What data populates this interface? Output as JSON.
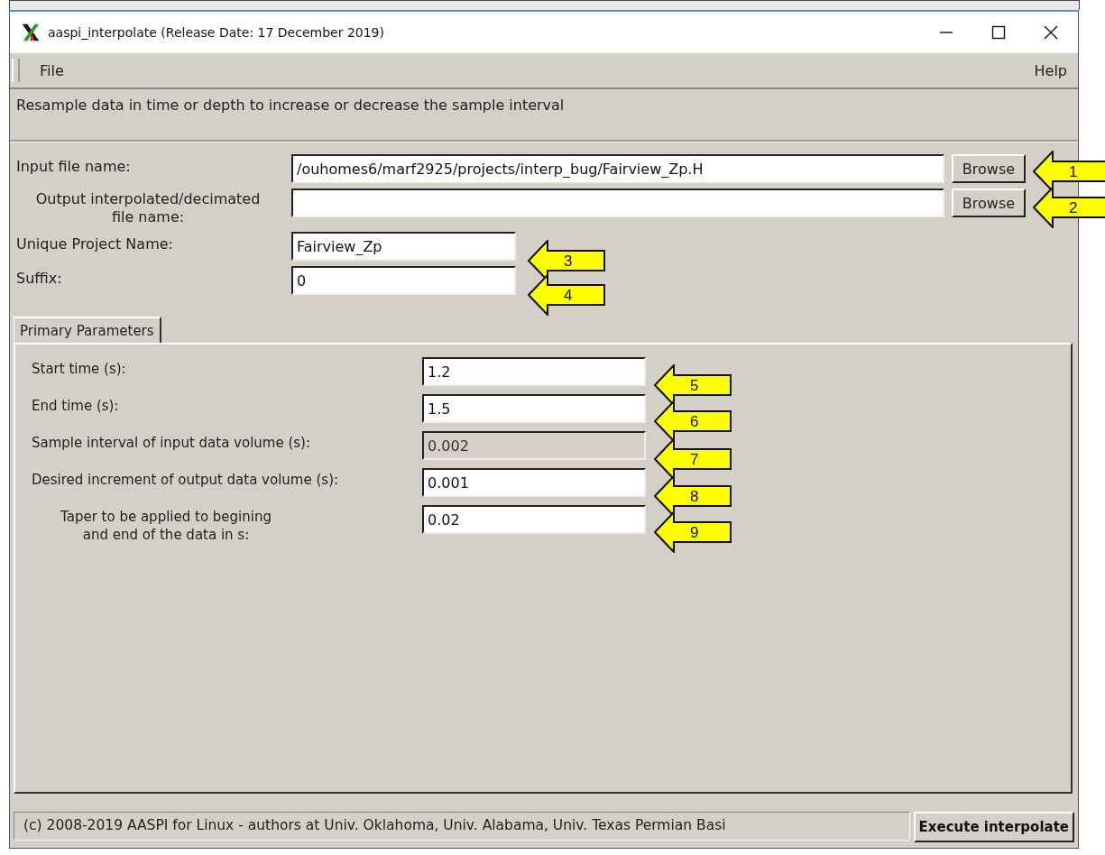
{
  "window": {
    "title": "aaspi_interpolate (Release Date: 17 December 2019)"
  },
  "menu": [
    {
      "label": "File"
    },
    {
      "label": "Help"
    }
  ],
  "description": "Resample data in time or depth to increase or decrease the sample interval",
  "file_fields": [
    {
      "label": "Input file name:",
      "value": "/ouhomes6/marf2925/projects/interp_bug/Fairview_Zp.H",
      "button": "Browse"
    },
    {
      "label": "Output interpolated/decimated\nfile name:",
      "button": "Browse"
    }
  ],
  "project_fields": [
    {
      "label": "Unique Project Name:",
      "value": "Fairview_Zp"
    },
    {
      "label": "Suffix:",
      "value": "0"
    }
  ],
  "tabs": [
    {
      "label": "Primary Parameters",
      "selected": true
    }
  ],
  "parameters": [
    {
      "label": "Start time (s):",
      "value": "1.2",
      "disabled": false
    },
    {
      "label": "End time (s):",
      "value": "1.5",
      "disabled": false
    },
    {
      "label": "Sample interval of input data volume (s):",
      "value": "0.002",
      "disabled": true
    },
    {
      "label": "Desired increment of output data volume (s):",
      "value": "0.001",
      "disabled": false
    },
    {
      "label": "Taper to be applied to begining\nand end of the data in s:",
      "value": "0.02",
      "disabled": false
    }
  ],
  "status_bar": "(c) 2008-2019 AASPI for Linux - authors at Univ. Oklahoma, Univ. Alabama, Univ. Texas Permian Basi",
  "execute_button": "Execute interpolate",
  "callouts": [
    "1",
    "2",
    "3",
    "4",
    "5",
    "6",
    "7",
    "8",
    "9"
  ]
}
